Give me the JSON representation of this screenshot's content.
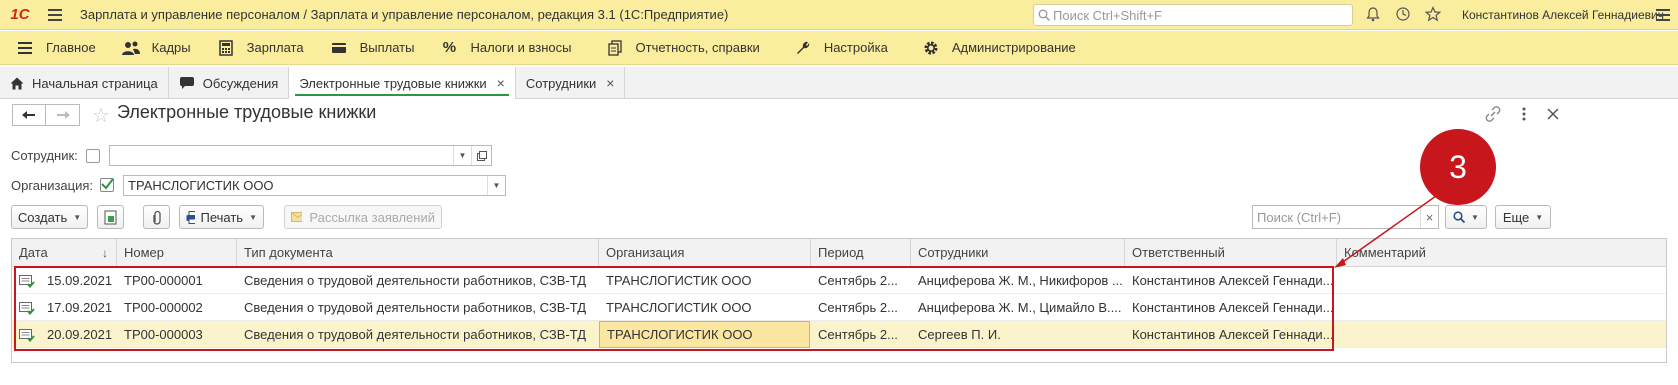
{
  "window": {
    "app_title": "Зарплата и управление персоналом / Зарплата и управление персоналом, редакция 3.1  (1С:Предприятие)",
    "logo_text": "1С",
    "global_search_placeholder": "Поиск Ctrl+Shift+F",
    "user_name": "Константинов Алексей Геннадиевич"
  },
  "sections": [
    {
      "label": "Главное",
      "icon": "menu-lines-icon"
    },
    {
      "label": "Кадры",
      "icon": "people-icon"
    },
    {
      "label": "Зарплата",
      "icon": "calculator-icon"
    },
    {
      "label": "Выплаты",
      "icon": "wallet-icon"
    },
    {
      "label": "Налоги и взносы",
      "icon": "percent-icon"
    },
    {
      "label": "Отчетность, справки",
      "icon": "documents-icon"
    },
    {
      "label": "Настройка",
      "icon": "wrench-icon"
    },
    {
      "label": "Администрирование",
      "icon": "gear-icon"
    }
  ],
  "tabs": [
    {
      "label": "Начальная страница",
      "icon": "home-icon"
    },
    {
      "label": "Обсуждения",
      "icon": "chat-icon"
    },
    {
      "label": "Электронные трудовые книжки",
      "active": true
    },
    {
      "label": "Сотрудники"
    }
  ],
  "form": {
    "title": "Электронные трудовые книжки"
  },
  "filters": {
    "employee_label": "Сотрудник:",
    "employee_checked": false,
    "employee_value": "",
    "org_label": "Организация:",
    "org_checked": true,
    "org_value": "ТРАНСЛОГИСТИК ООО"
  },
  "toolbar": {
    "create_label": "Создать",
    "print_label": "Печать",
    "mailing_label": "Рассылка заявлений",
    "search_placeholder": "Поиск (Ctrl+F)",
    "more_label": "Еще"
  },
  "table": {
    "columns": [
      "Дата",
      "Номер",
      "Тип документа",
      "Организация",
      "Период",
      "Сотрудники",
      "Ответственный",
      "Комментарий"
    ],
    "rows": [
      [
        "15.09.2021",
        "ТР00-000001",
        "Сведения о трудовой деятельности работников, СЗВ-ТД",
        "ТРАНСЛОГИСТИК ООО",
        "Сентябрь 2...",
        "Анциферова Ж. М., Никифоров ...",
        "Константинов Алексей Геннади...",
        ""
      ],
      [
        "17.09.2021",
        "ТР00-000002",
        "Сведения о трудовой деятельности работников, СЗВ-ТД",
        "ТРАНСЛОГИСТИК ООО",
        "Сентябрь 2...",
        "Анциферова Ж. М., Цимайло В....",
        "Константинов Алексей Геннади...",
        ""
      ],
      [
        "20.09.2021",
        "ТР00-000003",
        "Сведения о трудовой деятельности работников, СЗВ-ТД",
        "ТРАНСЛОГИСТИК ООО",
        "Сентябрь 2...",
        "Сергеев П. И.",
        "Константинов Алексей Геннади...",
        ""
      ]
    ],
    "selected_row": 2
  },
  "annotation": {
    "marker_label": "3",
    "color": "#c8161d"
  },
  "colors": {
    "header_bg": "#fbed9e",
    "accent_green": "#2c9640",
    "selected_row_bg": "#fbf3cb"
  }
}
